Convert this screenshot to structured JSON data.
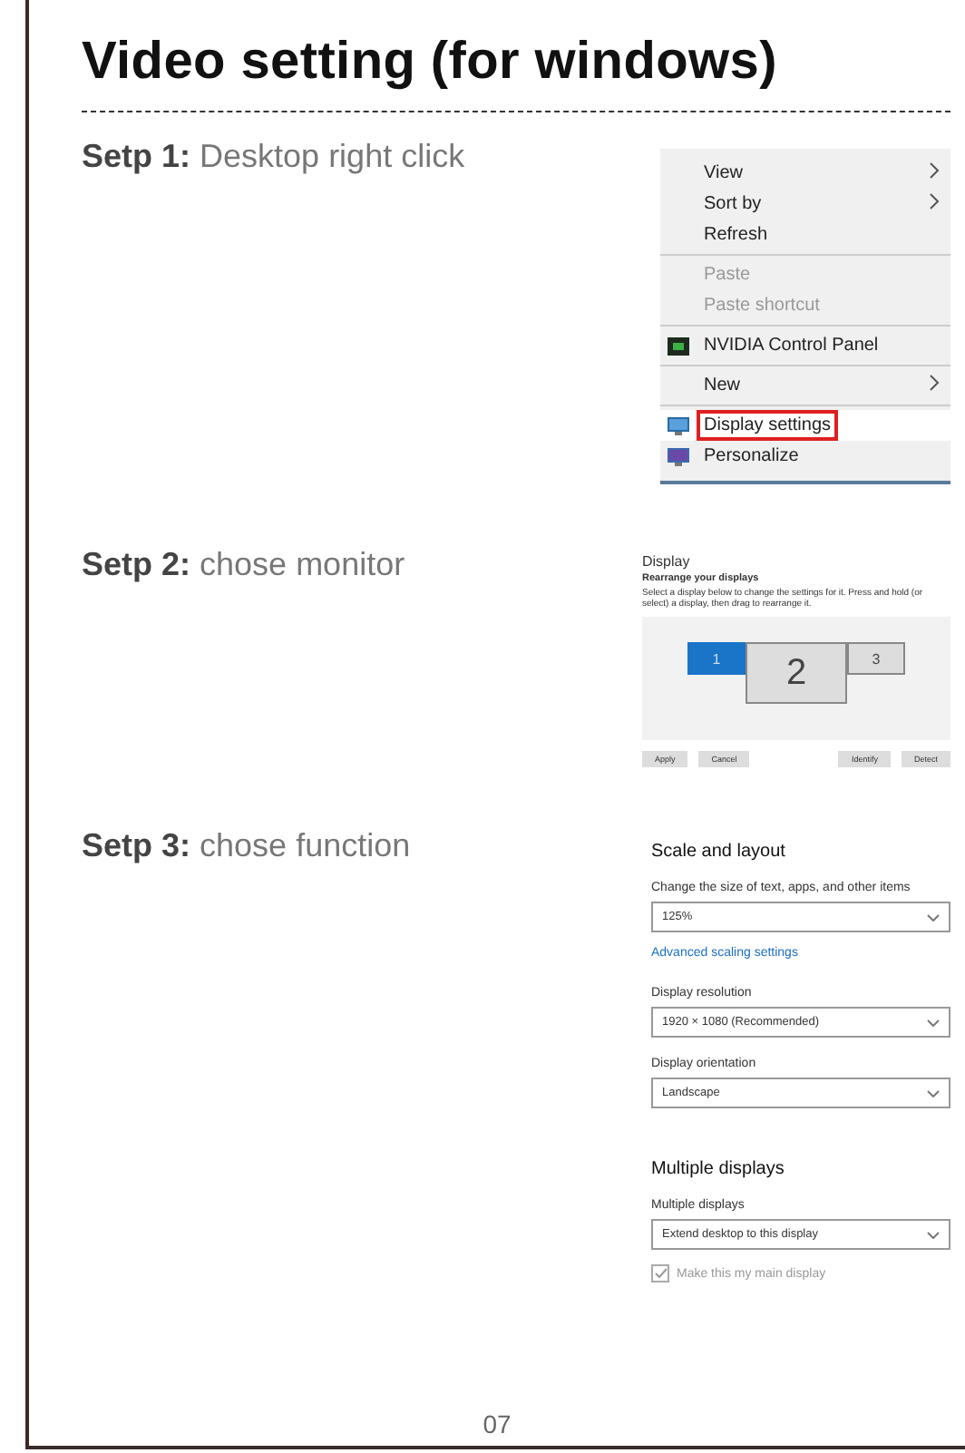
{
  "title": "Video setting (for windows)",
  "steps": [
    {
      "label": "Setp 1:",
      "text": "Desktop right click",
      "kind": "context_menu",
      "menu": {
        "groups": [
          [
            {
              "label": "View",
              "submenu": true,
              "disabled": false,
              "highlighted": false
            },
            {
              "label": "Sort by",
              "submenu": true,
              "disabled": false,
              "highlighted": false
            },
            {
              "label": "Refresh",
              "submenu": false,
              "disabled": false,
              "highlighted": false
            }
          ],
          [
            {
              "label": "Paste",
              "submenu": false,
              "disabled": true,
              "highlighted": false
            },
            {
              "label": "Paste shortcut",
              "submenu": false,
              "disabled": true,
              "highlighted": false
            }
          ],
          [
            {
              "label": "NVIDIA Control Panel",
              "submenu": false,
              "disabled": false,
              "highlighted": false
            }
          ],
          [
            {
              "label": "New",
              "submenu": true,
              "disabled": false,
              "highlighted": false
            }
          ],
          [
            {
              "label": "Display settings",
              "submenu": false,
              "disabled": false,
              "highlighted": true
            },
            {
              "label": "Personalize",
              "submenu": false,
              "disabled": false,
              "highlighted": false
            }
          ]
        ]
      }
    },
    {
      "label": "Setp 2:",
      "text": "chose monitor",
      "kind": "display_arrange",
      "panel": {
        "title": "Display",
        "subtitle": "Rearrange your displays",
        "description": "Select a display below to change the settings for it. Press and hold (or select) a display, then drag to rearrange it.",
        "monitors": [
          {
            "label": "1",
            "selected": true
          },
          {
            "label": "2",
            "selected": false
          },
          {
            "label": "3",
            "selected": false
          }
        ],
        "left_buttons": [
          "Apply",
          "Cancel"
        ],
        "right_buttons": [
          "Identify",
          "Detect"
        ]
      }
    },
    {
      "label": "Setp 3:",
      "text": "chose function",
      "kind": "settings",
      "settings": [
        {
          "kind": "heading",
          "text": "Scale and layout"
        },
        {
          "kind": "label",
          "text": "Change the size of text, apps, and other items"
        },
        {
          "kind": "dropdown",
          "text": "125%"
        },
        {
          "kind": "link",
          "text": "Advanced scaling settings"
        },
        {
          "kind": "label",
          "text": "Display resolution"
        },
        {
          "kind": "dropdown",
          "text": "1920 × 1080 (Recommended)"
        },
        {
          "kind": "label",
          "text": "Display orientation"
        },
        {
          "kind": "dropdown",
          "text": "Landscape"
        },
        {
          "kind": "heading",
          "text": "Multiple displays"
        },
        {
          "kind": "label",
          "text": "Multiple displays"
        },
        {
          "kind": "dropdown",
          "text": "Extend desktop to this display"
        },
        {
          "kind": "checkbox",
          "text": "Make this my main display",
          "checked": true
        }
      ]
    }
  ],
  "page_number": "07"
}
